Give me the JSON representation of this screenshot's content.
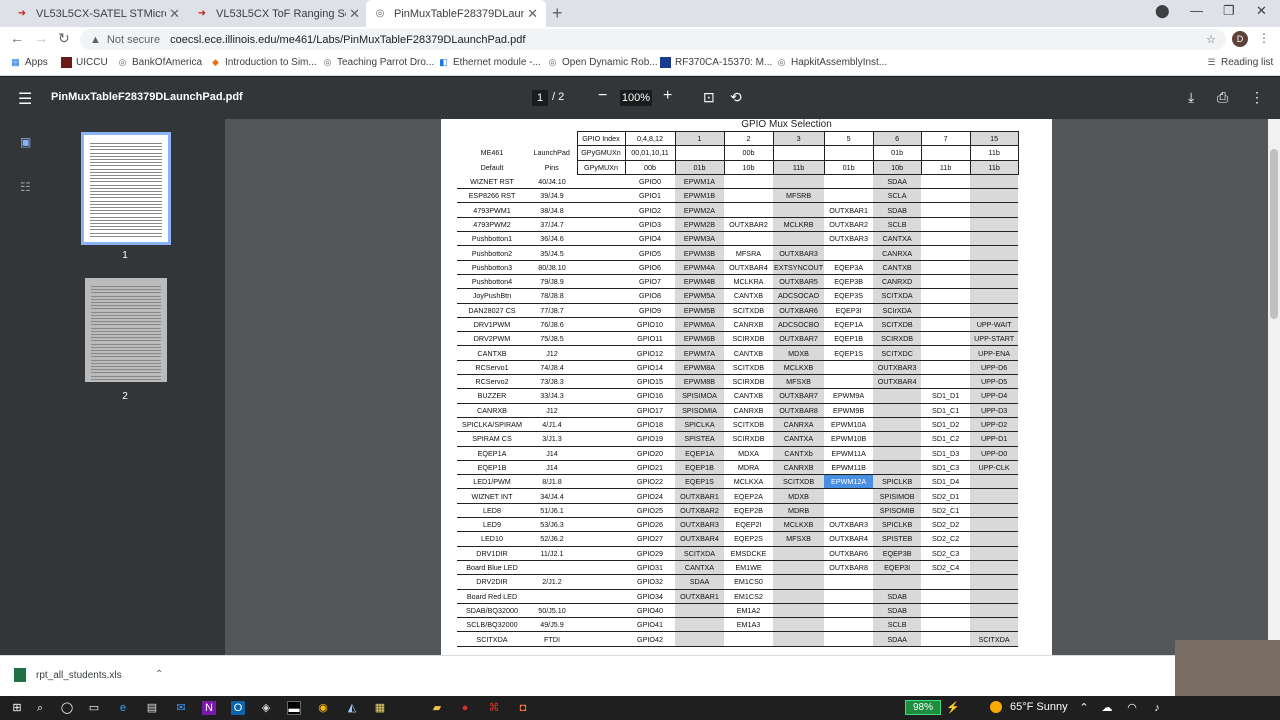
{
  "tabs": [
    {
      "title": "VL53L5CX-SATEL STMicroelectro",
      "icon": "st-icon"
    },
    {
      "title": "VL53L5CX ToF Ranging Sensor -",
      "icon": "st-icon"
    },
    {
      "title": "PinMuxTableF28379DLaunchPad",
      "icon": "globe-icon"
    }
  ],
  "address": {
    "security": "Not secure",
    "url": "coecsl.ece.illinois.edu/me461/Labs/PinMuxTableF28379DLaunchPad.pdf"
  },
  "profile_initial": "D",
  "bookmarks": [
    "Apps",
    "UICCU",
    "BankOfAmerica",
    "Introduction to Sim...",
    "Teaching Parrot Dro...",
    "Ethernet module -...",
    "Open Dynamic Rob...",
    "RF370CA-15370: M...",
    "HapkitAssemblyInst..."
  ],
  "reading_list": "Reading list",
  "pdf": {
    "filename": "PinMuxTableF28379DLaunchPad.pdf",
    "page": "1",
    "total": "/ 2",
    "zoom": "100%",
    "thumb_labels": [
      "1",
      "2"
    ]
  },
  "sheet": {
    "title": "GPIO Mux Selection",
    "header_rows": [
      [
        "",
        "",
        "GPIO Index",
        "0,4,8,12",
        "1",
        "2",
        "3",
        "5",
        "6",
        "7",
        "15"
      ],
      [
        "ME461",
        "LaunchPad",
        "GPyGMUXn",
        "00,01,10,11",
        "",
        "00b",
        "",
        "",
        "01b",
        "",
        "11b"
      ],
      [
        "Default",
        "Pins",
        "GPyMUXn",
        "00b",
        "01b",
        "10b",
        "11b",
        "01b",
        "10b",
        "11b",
        "11b"
      ]
    ],
    "rows": [
      [
        "WIZNET RST",
        "40/J4.10",
        "GPIO0",
        "EPWM1A",
        "",
        "",
        "",
        "SDAA",
        "",
        ""
      ],
      [
        "ESP8266 RST",
        "39/J4.9",
        "GPIO1",
        "EPWM1B",
        "",
        "MFSRB",
        "",
        "SCLA",
        "",
        ""
      ],
      [
        "4793PWM1",
        "38/J4.8",
        "GPIO2",
        "EPWM2A",
        "",
        "",
        "OUTXBAR1",
        "SDAB",
        "",
        ""
      ],
      [
        "4793PWM2",
        "37/J4.7",
        "GPIO3",
        "EPWM2B",
        "OUTXBAR2",
        "MCLKRB",
        "OUTXBAR2",
        "SCLB",
        "",
        ""
      ],
      [
        "Pushbotton1",
        "36/J4.6",
        "GPIO4",
        "EPWM3A",
        "",
        "",
        "OUTXBAR3",
        "CANTXA",
        "",
        ""
      ],
      [
        "Pushbotton2",
        "35/J4.5",
        "GPIO5",
        "EPWM3B",
        "MFSRA",
        "OUTXBAR3",
        "",
        "CANRXA",
        "",
        ""
      ],
      [
        "Pushbotton3",
        "80/J8.10",
        "GPIO6",
        "EPWM4A",
        "OUTXBAR4",
        "EXTSYNCOUT",
        "EQEP3A",
        "CANTXB",
        "",
        ""
      ],
      [
        "Pushbotton4",
        "79/J8.9",
        "GPIO7",
        "EPWM4B",
        "MCLKRA",
        "OUTXBAR5",
        "EQEP3B",
        "CANRXD",
        "",
        ""
      ],
      [
        "JoyPushBtn",
        "78/J8.8",
        "GPIO8",
        "EPWM5A",
        "CANTXB",
        "ADCSOCAO",
        "EQEP3S",
        "SCITXDA",
        "",
        ""
      ],
      [
        "DAN28027 CS",
        "77/J8.7",
        "GPIO9",
        "EPWM5B",
        "SCITXDB",
        "OUTXBAR6",
        "EQEP3I",
        "SCIrXDA",
        "",
        ""
      ],
      [
        "DRV1PWM",
        "76/J8.6",
        "GPIO10",
        "EPWM6A",
        "CANRXB",
        "ADCSOCBO",
        "EQEP1A",
        "SCITXDB",
        "",
        "UPP-WAIT"
      ],
      [
        "DRV2PWM",
        "75/J8.5",
        "GPIO11",
        "EPWM6B",
        "SCIRXDB",
        "OUTXBAR7",
        "EQEP1B",
        "SCIRXDB",
        "",
        "UPP-START"
      ],
      [
        "CANTXB",
        "J12",
        "GPIO12",
        "EPWM7A",
        "CANTXB",
        "MDXB",
        "EQEP1S",
        "SCITXDC",
        "",
        "UPP-ENA"
      ],
      [
        "RCServo1",
        "74/J8.4",
        "GPIO14",
        "EPWM8A",
        "SCITXDB",
        "MCLKXB",
        "",
        "OUTXBAR3",
        "",
        "UPP-D6"
      ],
      [
        "RCServo2",
        "73/J8.3",
        "GPIO15",
        "EPWM8B",
        "SCIRXDB",
        "MFSXB",
        "",
        "OUTXBAR4",
        "",
        "UPP-D5"
      ],
      [
        "BUZZER",
        "33/J4.3",
        "GPIO16",
        "SPISIMOA",
        "CANTXB",
        "OUTXBAR7",
        "EPWM9A",
        "",
        "SD1_D1",
        "UPP-D4"
      ],
      [
        "CANRXB",
        "J12",
        "GPIO17",
        "SPISOMIA",
        "CANRXB",
        "OUTXBAR8",
        "EPWM9B",
        "",
        "SD1_C1",
        "UPP-D3"
      ],
      [
        "SPICLKA/SPIRAM",
        "4/J1.4",
        "GPIO18",
        "SPICLKA",
        "SCITXDB",
        "CANRXA",
        "EPWM10A",
        "",
        "SD1_D2",
        "UPP-D2"
      ],
      [
        "SPIRAM CS",
        "3/J1.3",
        "GPIO19",
        "SPISTEA",
        "SCIRXDB",
        "CANTXA",
        "EPWM10B",
        "",
        "SD1_C2",
        "UPP-D1"
      ],
      [
        "EQEP1A",
        "J14",
        "GPIO20",
        "EQEP1A",
        "MDXA",
        "CANTXb",
        "EPWM11A",
        "",
        "SD1_D3",
        "UPP-D0"
      ],
      [
        "EQEP1B",
        "J14",
        "GPIO21",
        "EQEP1B",
        "MDRA",
        "CANRXB",
        "EPWM11B",
        "",
        "SD1_C3",
        "UPP-CLK"
      ],
      [
        "LED1/PWM",
        "8/J1.8",
        "GPIO22",
        "EQEP1S",
        "MCLKXA",
        "SCITXDB",
        "EPWM12A",
        "SPICLKB",
        "SD1_D4",
        ""
      ],
      [
        "WIZNET INT",
        "34/J4.4",
        "GPIO24",
        "OUTXBAR1",
        "EQEP2A",
        "MDXB",
        "",
        "SPISIMOB",
        "SD2_D1",
        ""
      ],
      [
        "LED8",
        "51/J6.1",
        "GPIO25",
        "OUTXBAR2",
        "EQEP2B",
        "MDRB",
        "",
        "SPISOMIB",
        "SD2_C1",
        ""
      ],
      [
        "LED9",
        "53/J6.3",
        "GPIO26",
        "OUTXBAR3",
        "EQEP2I",
        "MCLKXB",
        "OUTXBAR3",
        "SPICLKB",
        "SD2_D2",
        ""
      ],
      [
        "LED10",
        "52/J6.2",
        "GPIO27",
        "OUTXBAR4",
        "EQEP2S",
        "MFSXB",
        "OUTXBAR4",
        "SPISTEB",
        "SD2_C2",
        ""
      ],
      [
        "DRV1DIR",
        "11/J2.1",
        "GPIO29",
        "SCITXDA",
        "EMSDCKE",
        "",
        "OUTXBAR6",
        "EQEP3B",
        "SD2_C3",
        ""
      ],
      [
        "Board Blue LED",
        "",
        "GPIO31",
        "CANTXA",
        "EM1WE",
        "",
        "OUTXBAR8",
        "EQEP3I",
        "SD2_C4",
        ""
      ],
      [
        "DRV2DIR",
        "2/J1.2",
        "GPIO32",
        "SDAA",
        "EM1CS0",
        "",
        "",
        "",
        "",
        ""
      ],
      [
        "Board Red LED",
        "",
        "GPIO34",
        "OUTXBAR1",
        "EM1CS2",
        "",
        "",
        "SDAB",
        "",
        ""
      ],
      [
        "SDAB/BQ32000",
        "50/J5.10",
        "GPIO40",
        "",
        "EM1A2",
        "",
        "",
        "SDAB",
        "",
        ""
      ],
      [
        "SCLB/BQ32000",
        "49/J5.9",
        "GPIO41",
        "",
        "EM1A3",
        "",
        "",
        "SCLB",
        "",
        ""
      ],
      [
        "SCITXDA",
        "FTDI",
        "GPIO42",
        "",
        "",
        "",
        "",
        "SDAA",
        "",
        "SCITXDA"
      ]
    ]
  },
  "download": {
    "filename": "rpt_all_students.xls"
  },
  "taskbar": {
    "battery": "98%",
    "weather": "65°F  Sunny"
  }
}
